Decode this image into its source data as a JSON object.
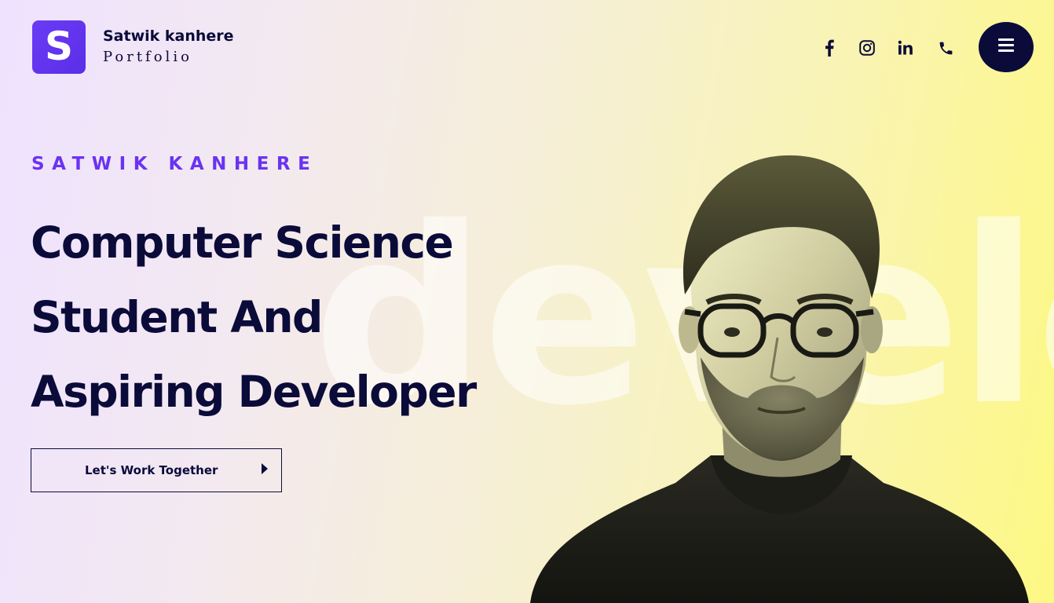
{
  "brand": {
    "logo_letter": "S",
    "name": "Satwik kanhere",
    "subtitle": "Portfolio"
  },
  "social": [
    {
      "icon": "facebook-icon"
    },
    {
      "icon": "instagram-icon"
    },
    {
      "icon": "linkedin-icon",
      "label": "in"
    },
    {
      "icon": "phone-icon"
    }
  ],
  "menu": {
    "icon": "hamburger-menu-icon"
  },
  "hero": {
    "eyebrow": "SATWIK KANHERE",
    "headline_lines": [
      "Computer Science",
      "Student And",
      "Aspiring Developer"
    ],
    "cta_label": "Let's Work Together",
    "cta_icon": "caret-right-icon",
    "watermark": "develo"
  },
  "colors": {
    "accent": "#6a33f2",
    "ink": "#0b0b3a",
    "gradient_start": "#efe2ff",
    "gradient_end": "#fdf883"
  }
}
